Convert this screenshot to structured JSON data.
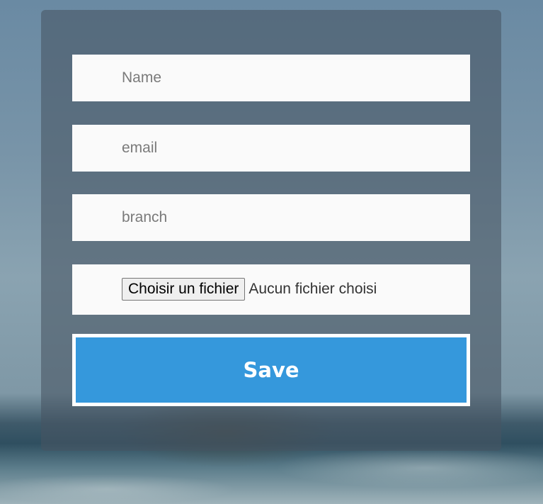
{
  "form": {
    "name_placeholder": "Name",
    "email_placeholder": "email",
    "branch_placeholder": "branch",
    "name_value": "",
    "email_value": "",
    "branch_value": "",
    "file_button_label": "Choisir un fichier",
    "file_status": "Aucun fichier choisi",
    "save_label": "Save"
  },
  "colors": {
    "save_button": "#3598dc",
    "input_background": "#fafafa",
    "panel_overlay": "#465562"
  }
}
